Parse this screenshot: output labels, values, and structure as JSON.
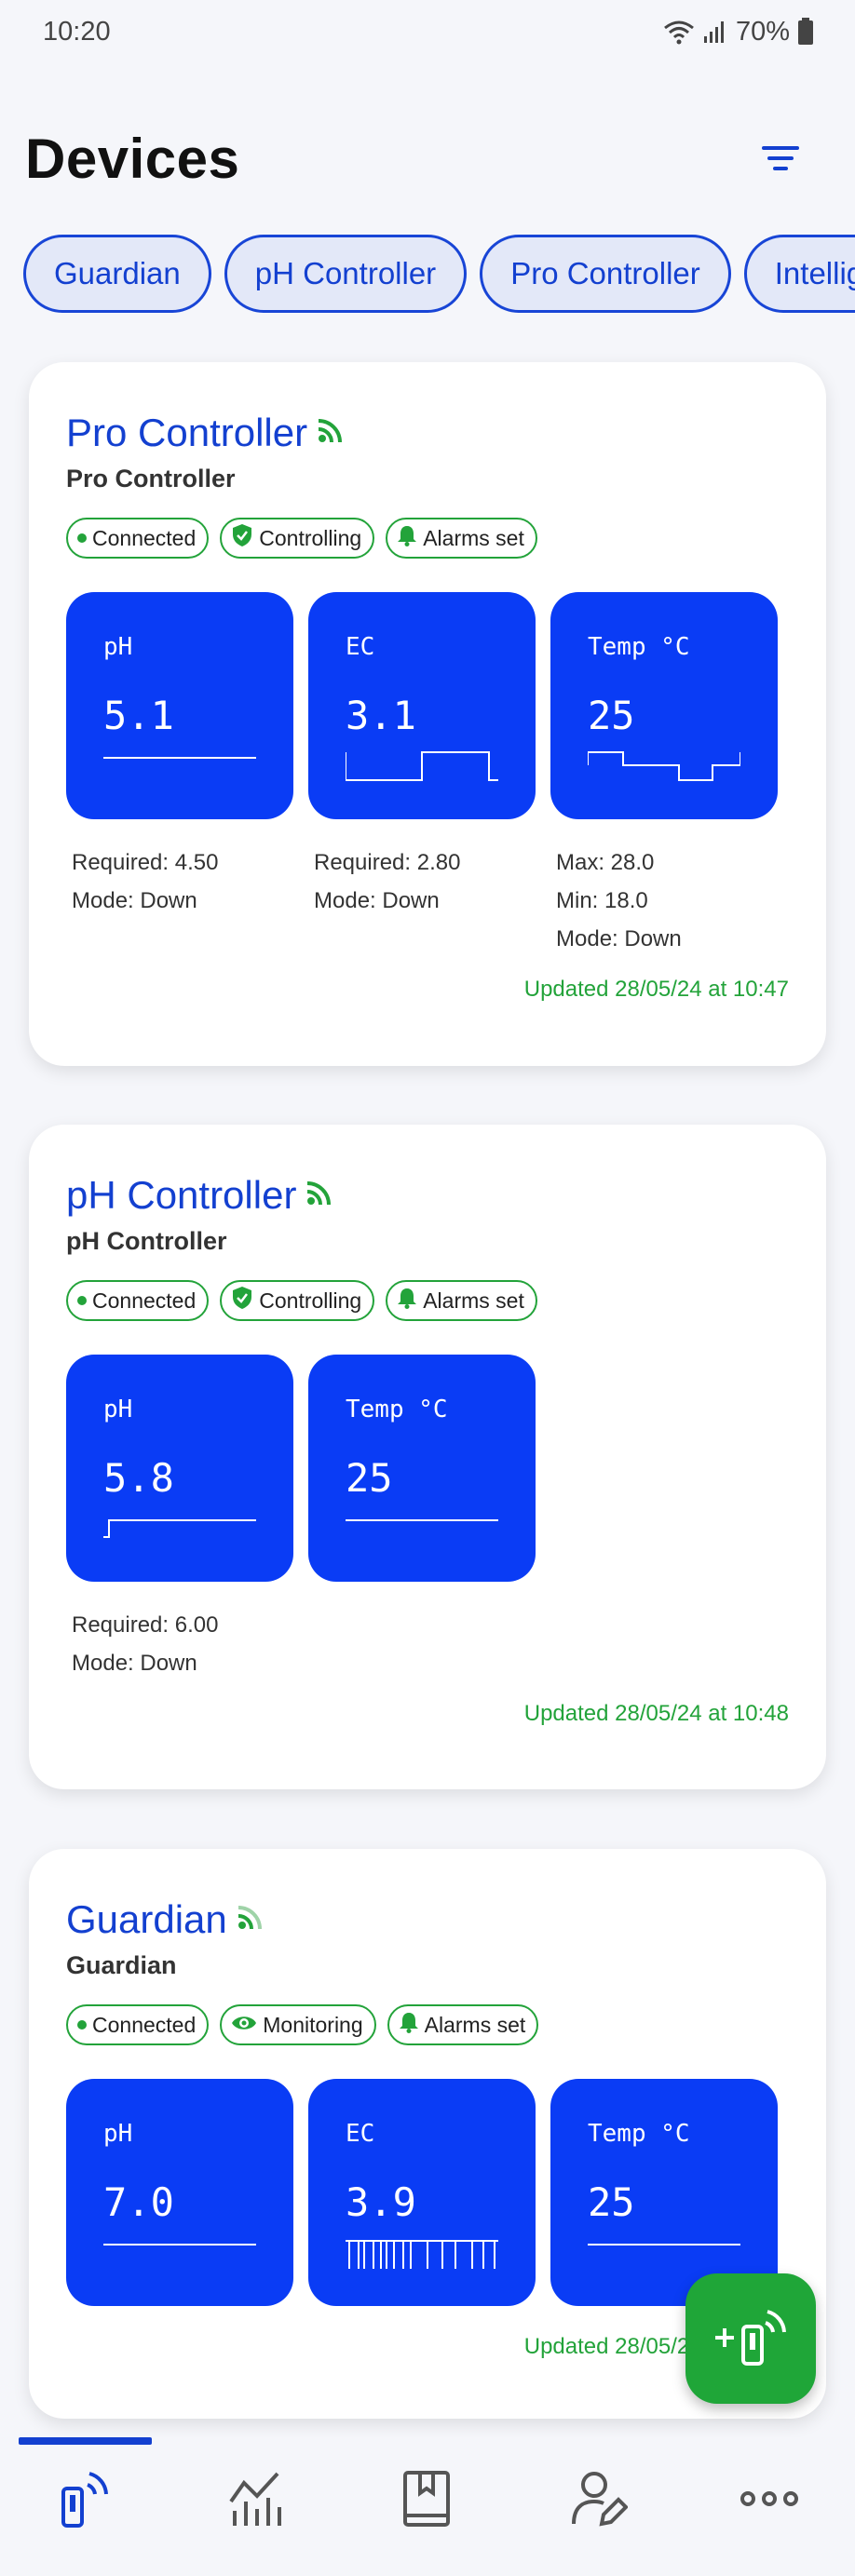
{
  "status_bar": {
    "time": "10:20",
    "battery": "70%"
  },
  "header": {
    "title": "Devices"
  },
  "chips": [
    "Guardian",
    "pH Controller",
    "Pro Controller",
    "Intelligent Controller"
  ],
  "devices": [
    {
      "name": "Pro Controller",
      "type": "Pro Controller",
      "badges": [
        "Connected",
        "Controlling",
        "Alarms set"
      ],
      "tiles": [
        {
          "label": "pH",
          "value": "5.1"
        },
        {
          "label": "EC",
          "value": "3.1"
        },
        {
          "label": "Temp °C",
          "value": "25"
        }
      ],
      "info": [
        [
          "Required: 4.50",
          "Mode: Down"
        ],
        [
          "Required: 2.80",
          "Mode: Down"
        ],
        [
          "Max: 28.0",
          "Min: 18.0",
          "Mode: Down"
        ]
      ],
      "updated": "Updated 28/05/24 at 10:47"
    },
    {
      "name": "pH Controller",
      "type": "pH Controller",
      "badges": [
        "Connected",
        "Controlling",
        "Alarms set"
      ],
      "tiles": [
        {
          "label": "pH",
          "value": "5.8"
        },
        {
          "label": "Temp °C",
          "value": "25"
        }
      ],
      "info": [
        [
          "Required: 6.00",
          "Mode: Down"
        ]
      ],
      "updated": "Updated 28/05/24 at 10:48"
    },
    {
      "name": "Guardian",
      "type": "Guardian",
      "badges": [
        "Connected",
        "Monitoring",
        "Alarms set"
      ],
      "tiles": [
        {
          "label": "pH",
          "value": "7.0"
        },
        {
          "label": "EC",
          "value": "3.9"
        },
        {
          "label": "Temp °C",
          "value": "25"
        }
      ],
      "updated": "Updated 28/05/24 at 10:48"
    }
  ],
  "colors": {
    "accent": "#1340d0",
    "tile": "#0a3cf5",
    "status_green": "#23a33a",
    "fab": "#1fa638"
  },
  "nav": [
    "devices-icon",
    "charts-icon",
    "book-icon",
    "user-edit-icon",
    "more-icon"
  ]
}
